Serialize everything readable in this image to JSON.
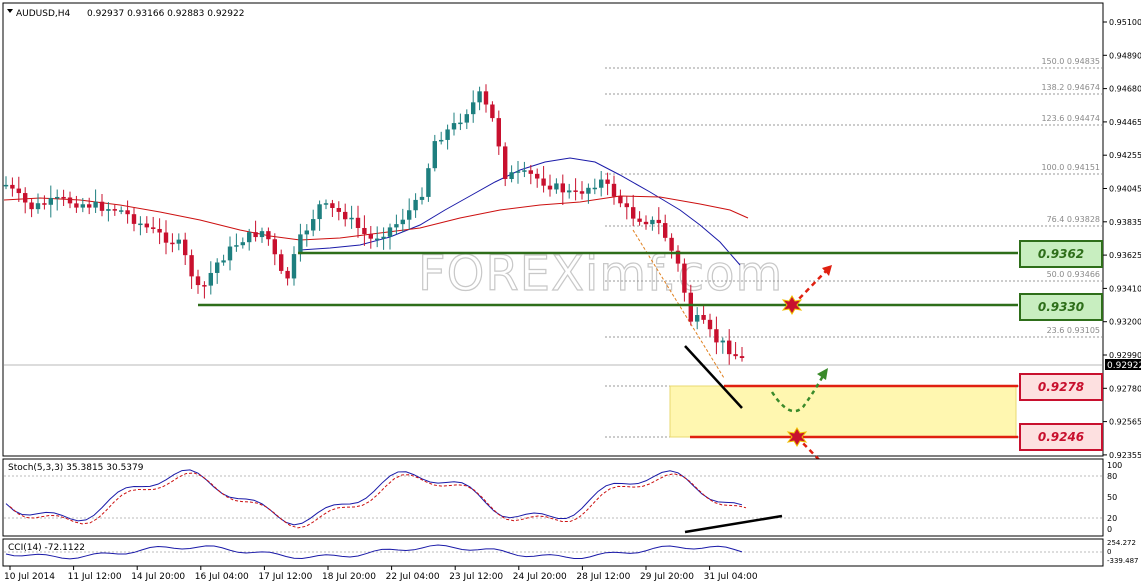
{
  "header": {
    "symbol": "AUDUSD,H4",
    "ohlc": "0.92937 0.93166 0.92883 0.92922"
  },
  "watermark": "FOREXimf.com",
  "price_axis": {
    "ticks": [
      "0.95100",
      "0.94890",
      "0.94680",
      "0.94465",
      "0.94255",
      "0.94045",
      "0.93835",
      "0.93625",
      "0.93410",
      "0.93200",
      "0.92990",
      "0.92780",
      "0.92565",
      "0.92355"
    ],
    "current": "0.92922"
  },
  "fib_levels": [
    {
      "label": "150.0 0.94835"
    },
    {
      "label": "138.2 0.94674"
    },
    {
      "label": "123.6 0.94474"
    },
    {
      "label": "100.0 0.94151"
    },
    {
      "label": "76.4 0.93828"
    },
    {
      "label": "50.0 0.93466"
    },
    {
      "label": "23.6 0.93105"
    }
  ],
  "levels": {
    "r1": "0.9362",
    "r2": "0.9330",
    "s1": "0.9278",
    "s2": "0.9246"
  },
  "stoch": {
    "title": "Stoch(5,3,3) 35.3815 30.5379",
    "ticks": [
      "100",
      "80",
      "50",
      "20",
      "0"
    ]
  },
  "cci": {
    "title": "CCI(14) -72.1122",
    "ticks": [
      "254.272",
      "0",
      "-339.487"
    ]
  },
  "time_axis": [
    "10 Jul 2014",
    "11 Jul 12:00",
    "14 Jul 20:00",
    "16 Jul 04:00",
    "17 Jul 12:00",
    "18 Jul 20:00",
    "22 Jul 04:00",
    "23 Jul 12:00",
    "24 Jul 20:00",
    "28 Jul 12:00",
    "29 Jul 20:00",
    "31 Jul 04:00"
  ],
  "colors": {
    "bull": "#1e7f7f",
    "bear": "#c8102e",
    "resistance": "#2e6e1a",
    "support": "#e02010",
    "zone": "#fff7b0",
    "ma_fast": "#1a1aa8",
    "ma_slow": "#cc1010"
  }
}
